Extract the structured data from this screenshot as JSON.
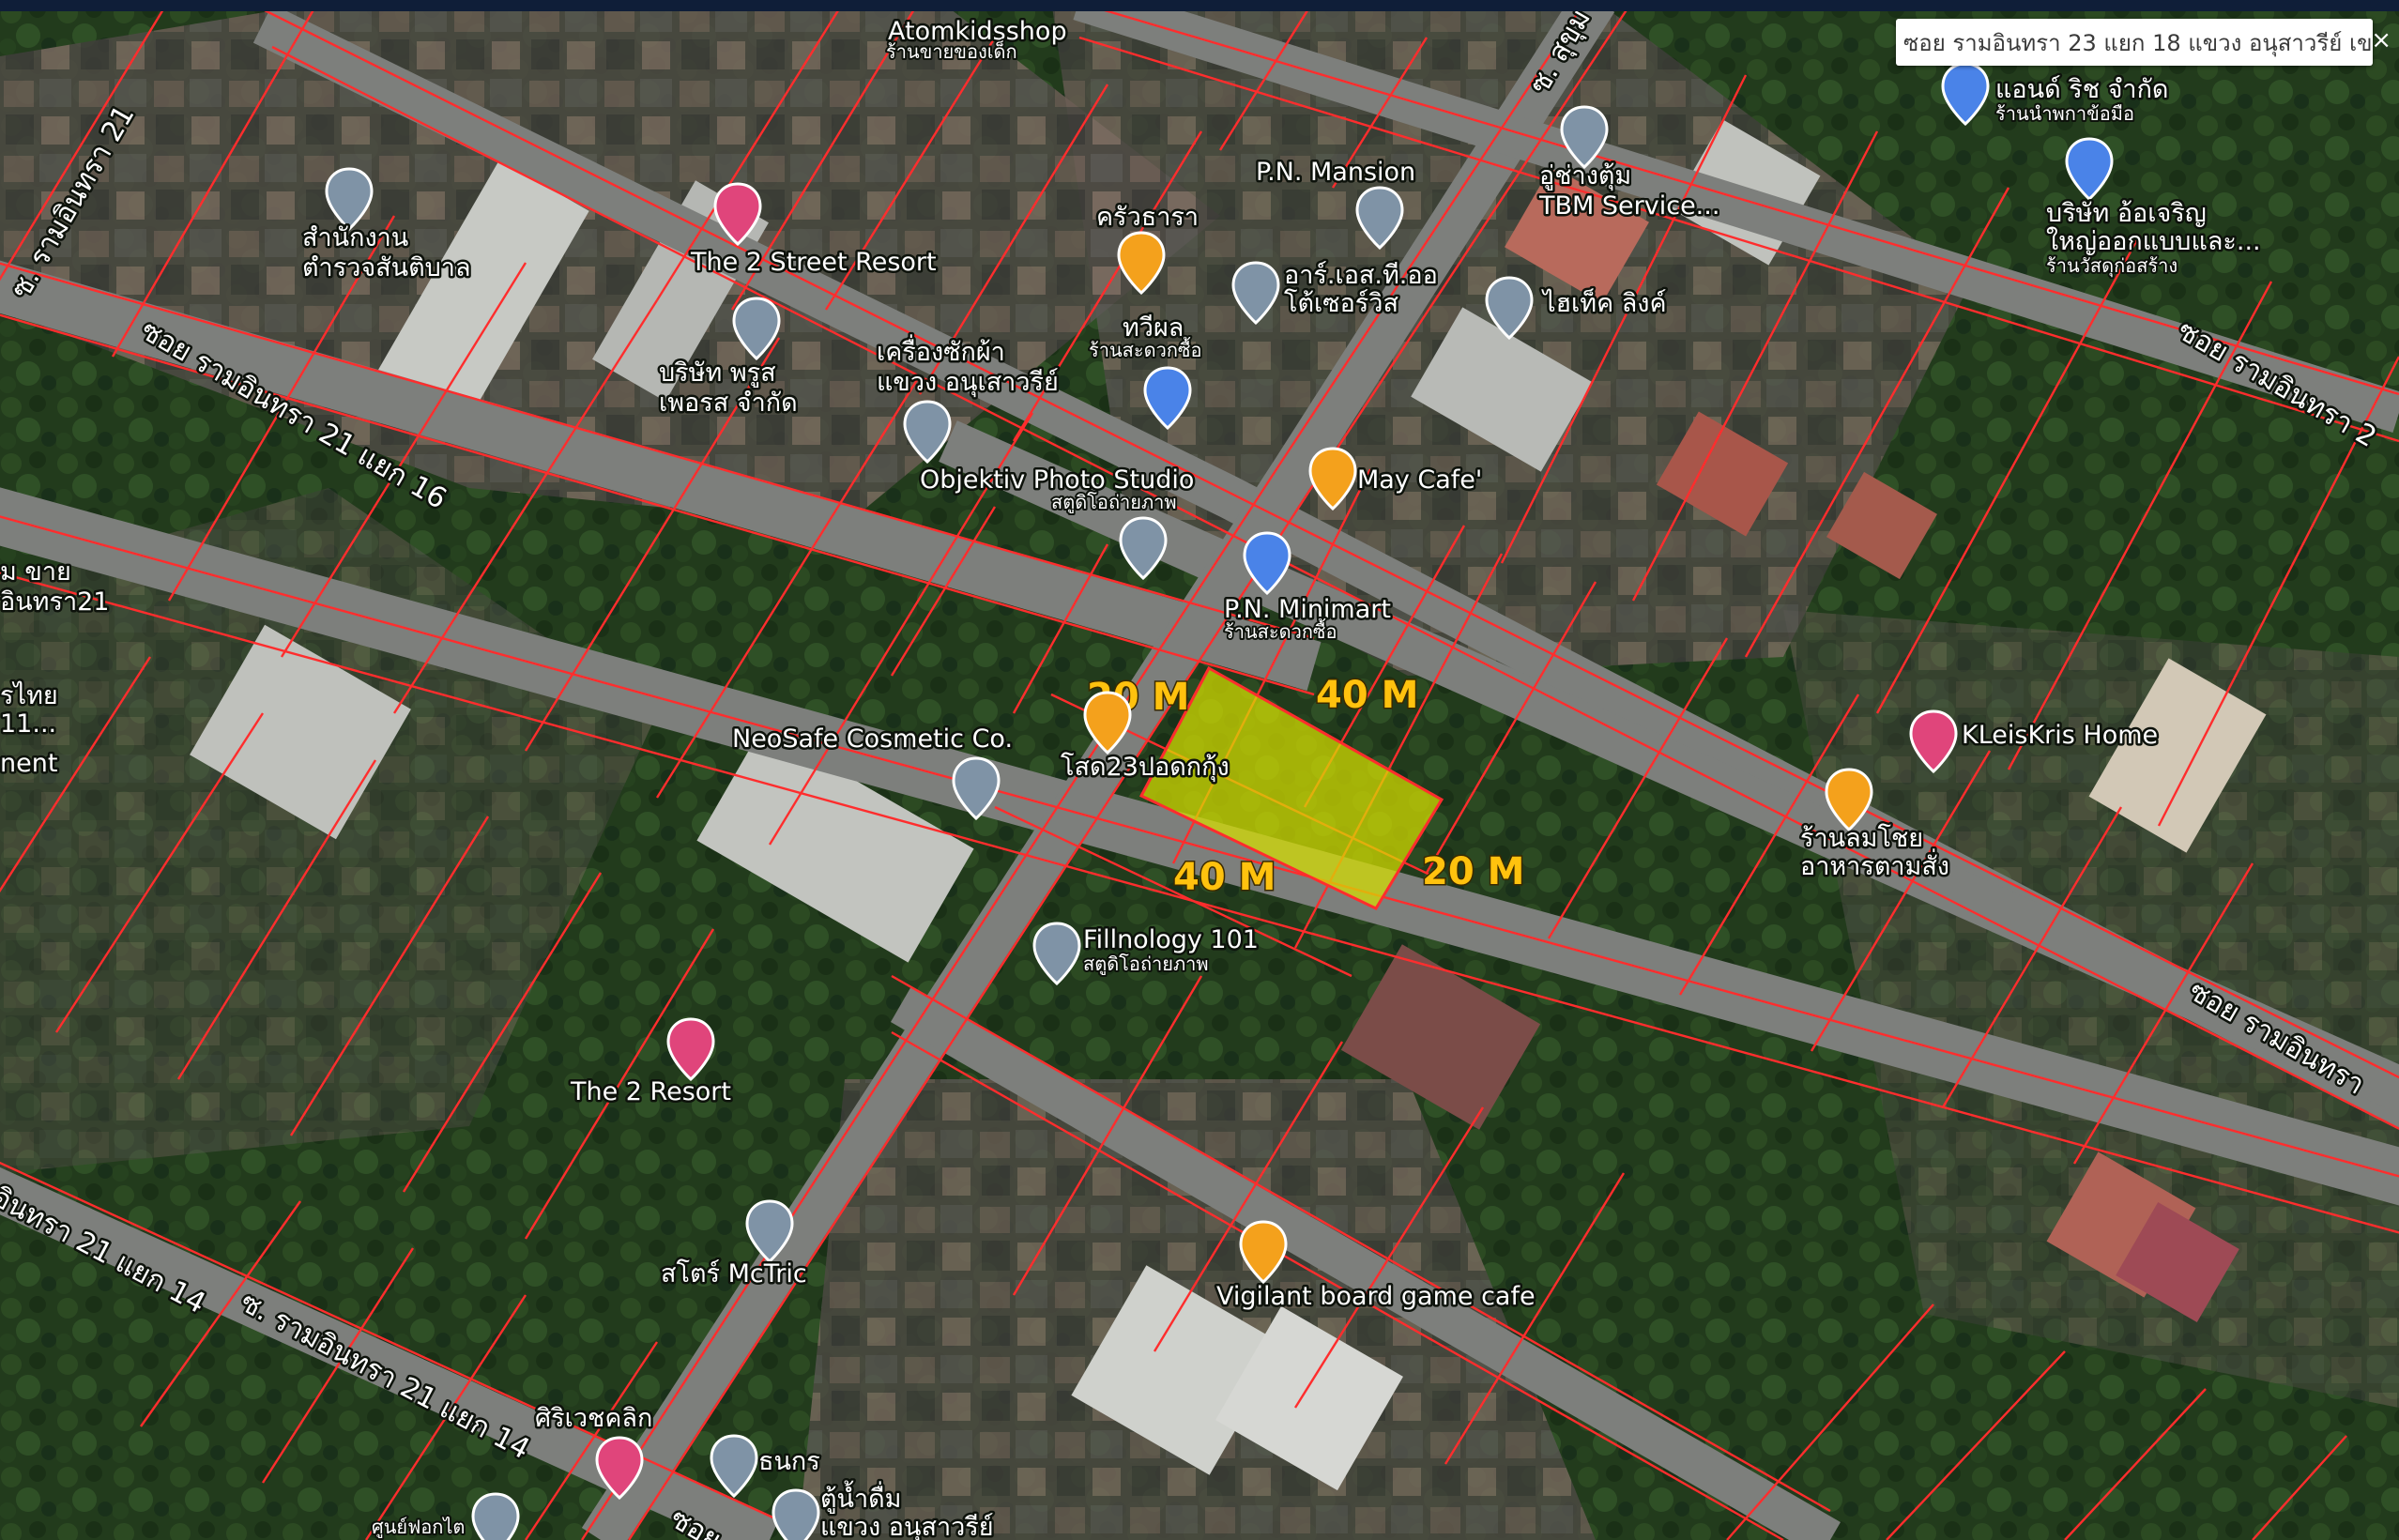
{
  "search": {
    "query": "ซอย รามอินทรา 23 แยก 18 แขวง อนุสาวรีย์ เข",
    "close_label": "×"
  },
  "dimensions": {
    "top": "40 M",
    "left": "20 M",
    "right": "20 M",
    "bottom": "40 M"
  },
  "roads": {
    "r21": "ซ. รามอินทรา 21",
    "r21_16": "ซอย รามอินทรา 21 แยก 16",
    "r21_14_a": "อินทรา 21 แยก 14",
    "r21_14_b": "ซ. รามอินทรา 21 แยก 14",
    "sukhum": "ซ. สุขุม",
    "r2_right": "ซอย รามอินทรา 2",
    "r_right_lower": "ซอย รามอินทรา",
    "bottom": "ซอย"
  },
  "pois": {
    "atomkids": {
      "name": "Atomkidsshop",
      "sub": "ร้านขายของเด็ก"
    },
    "two_street": {
      "name": "The 2 Street Resort"
    },
    "police": {
      "name": "สำนักงาน",
      "sub": "ตำรวจสันติบาล"
    },
    "prus": {
      "name": "บริษัท พรูส",
      "sub": "เพอรส จำกัด"
    },
    "washer": {
      "name": "เครื่องซักผ้า",
      "sub": "แขวง อนุเสาวรีย์"
    },
    "krua": {
      "name": "ครัวธารา"
    },
    "thwiphon": {
      "name": "ทวีผล",
      "sub": "ร้านสะดวกซื้อ"
    },
    "rst": {
      "name": "อาร์.เอส.ที.ออ",
      "sub": "โต้เซอร์วิส"
    },
    "pn_mansion": {
      "name": "P.N. Mansion"
    },
    "tbm": {
      "name": "อู่ช่างตุ้ม",
      "sub": "TBM Service..."
    },
    "hitech": {
      "name": "ไฮเท็ค ลิงค์"
    },
    "objektiv": {
      "name": "Objektiv Photo Studio",
      "sub": "สตูดิโอถ่ายภาพ"
    },
    "may_cafe": {
      "name": "May Cafe'"
    },
    "pn_minimart": {
      "name": "P.N. Minimart",
      "sub": "ร้านสะดวกซื้อ"
    },
    "neosafe": {
      "name": "NeoSafe Cosmetic Co."
    },
    "sod23": {
      "name": "โสด23ปอดกกุ้ง"
    },
    "fillnology": {
      "name": "Fillnology 101",
      "sub": "สตูดิโอถ่ายภาพ"
    },
    "two_resort": {
      "name": "The 2 Resort"
    },
    "mctric": {
      "name": "สโตร์ McTric"
    },
    "vigilant": {
      "name": "Vigilant board game cafe"
    },
    "siri": {
      "name": "ศิริเวชคลิก"
    },
    "thanakorn": {
      "name": "ธนกร"
    },
    "water": {
      "name": "ตู้น้ำดื่ม",
      "sub": "แขวง อนุสาวรีย์"
    },
    "photocopy": {
      "name": "ศูนย์ฟอกไต"
    },
    "kleis": {
      "name": "KLeisKris Home"
    },
    "lomchoi": {
      "name": "ร้านลมโชย",
      "sub": "อาหารตามสั่ง"
    },
    "and_rich": {
      "name": "แอนด์ ริช จำกัด",
      "sub": "ร้านนำพกาข้อมือ"
    },
    "aucharoen": {
      "name": "บริษัท อ้อเจริญ",
      "sub": "ใหญ่ออกแบบและ..."
    },
    "aucharoen_sub2": {
      "name": "ร้านวัสดุก่อสร้าง"
    },
    "left_sale": {
      "name": "ม ขาย",
      "sub": "อินทรา21"
    },
    "left_thai": {
      "name": "รไทย",
      "sub": "11..."
    },
    "left_ment": {
      "name": "nent"
    }
  },
  "colors": {
    "parcel": "#ff2d2d",
    "highlight": "#d7e000",
    "dim_text": "#ffc20e",
    "pin_gray": "#7f93a6",
    "pin_orange": "#f4a11c",
    "pin_pink": "#e0457b",
    "pin_blue": "#4a83e8"
  }
}
